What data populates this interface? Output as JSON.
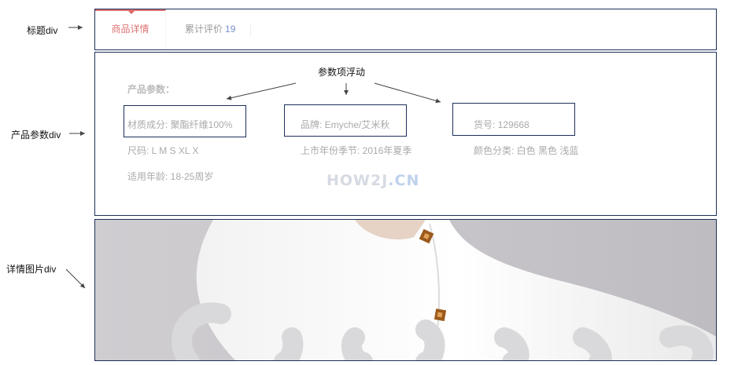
{
  "labels": {
    "title_div": "标题div",
    "params_div": "产品参数div",
    "image_div": "详情图片div",
    "float_note": "参数项浮动"
  },
  "tabs": {
    "detail": "商品详情",
    "review": "累计评价",
    "review_count": "19"
  },
  "params": {
    "heading": "产品参数：",
    "items": [
      "材质成分: 聚酯纤维100%",
      "品牌: Emyche/艾米秋",
      "货号: 129668",
      "尺码: L M S XL X",
      "上市年份季节: 2016年夏季",
      "颜色分类: 白色 黑色 浅蓝",
      "适用年龄: 18-25周岁"
    ]
  },
  "watermark": {
    "main": "HOW2J",
    "suffix": ".CN"
  },
  "colors": {
    "frame": "#1c2f5c",
    "accent_red": "#c40000",
    "count_blue": "#3f63b8",
    "param_text": "#aaaaaa"
  }
}
